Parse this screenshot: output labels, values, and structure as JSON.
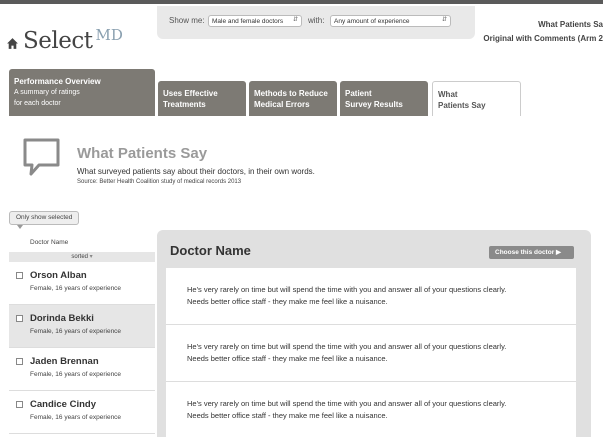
{
  "brand": {
    "name": "Select",
    "suffix": "MD"
  },
  "filters": {
    "show_me_label": "Show me:",
    "show_me_value": "Male and female doctors",
    "with_label": "with:",
    "with_value": "Any amount of experience"
  },
  "top_right": {
    "line1": "What Patients Sa",
    "line2": "Original with Comments (Arm 2"
  },
  "tabs": [
    {
      "label": "Performance Overview",
      "sub1": "A summary of ratings",
      "sub2": "for each doctor"
    },
    {
      "label1": "Uses Effective",
      "label2": "Treatments"
    },
    {
      "label1": "Methods to Reduce",
      "label2": "Medical Errors"
    },
    {
      "label1": "Patient",
      "label2": "Survey Results"
    },
    {
      "label1": "What",
      "label2": "Patients Say"
    }
  ],
  "page": {
    "title": "What Patients Say",
    "description": "What surveyed patients say about their doctors, in their own words.",
    "source": "Source: Better Health Coalition study of medical records 2013"
  },
  "sidebar": {
    "only_selected_label": "Only show selected",
    "column_header": "Doctor Name",
    "sorted_label": "sorted",
    "doctors": [
      {
        "name": "Orson Alban",
        "meta": "Female, 16 years of experience"
      },
      {
        "name": "Dorinda Bekki",
        "meta": "Female, 16 years of experience"
      },
      {
        "name": "Jaden Brennan",
        "meta": "Female, 16 years of experience"
      },
      {
        "name": "Candice Cindy",
        "meta": "Female, 16 years of experience"
      }
    ]
  },
  "panel": {
    "doctor_name": "Doctor Name",
    "choose_label": "Choose this doctor ▶",
    "comments": [
      {
        "line1": "He's very rarely on time but will spend the time with you and answer all of your questions clearly.",
        "line2": "Needs better office staff - they make me feel like a nuisance."
      },
      {
        "line1": "He's very rarely on time but will spend the time with you and answer all of your questions clearly.",
        "line2": "Needs better office staff - they make me feel like a nuisance."
      },
      {
        "line1": "He's very rarely on time but will spend the time with you and answer all of your questions clearly.",
        "line2": "Needs better office staff - they make me feel like a nuisance."
      }
    ]
  },
  "icons": {
    "home": "home-icon",
    "bubble": "speech-bubble-icon",
    "dropdown": "chevron-updown-icon",
    "sort": "sort-caret-icon"
  },
  "colors": {
    "tab_bg": "#7d7a74",
    "panel_bg": "#e0e0e0",
    "title_gray": "#9a9a9a",
    "choose_btn": "#8a8a8a"
  }
}
